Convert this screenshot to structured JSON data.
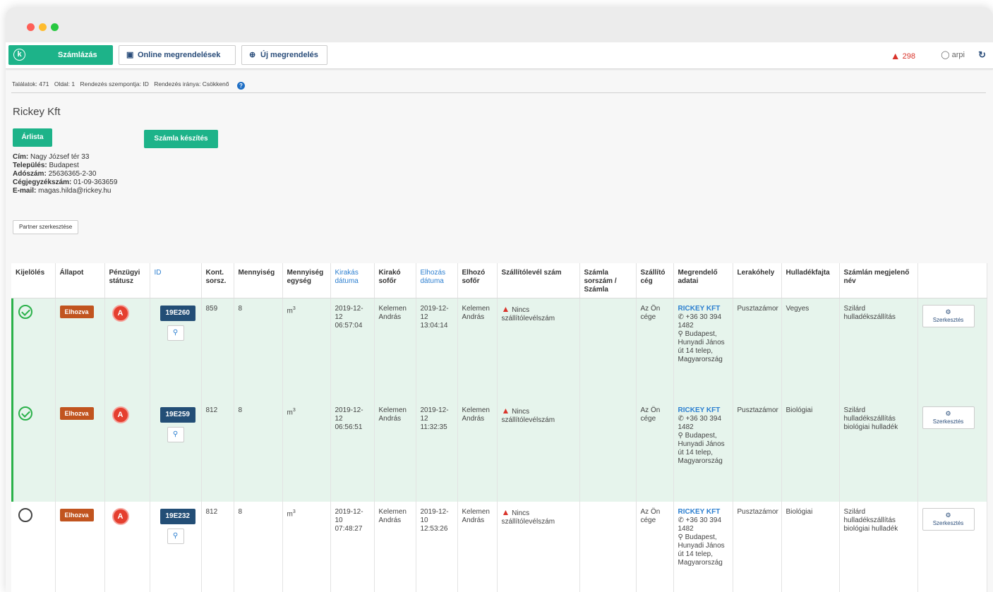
{
  "navbar": {
    "brand_logo": "k",
    "brand_label": "Számlázás",
    "online_orders": "Online megrendelések",
    "new_order": "Új megrendelés",
    "alert_count": "298",
    "user": "arpi"
  },
  "meta": {
    "results": "Találatok: 471",
    "page": "Oldal: 1",
    "sort_by": "Rendezés szempontja: ID",
    "sort_dir": "Rendezés iránya: Csökkenő"
  },
  "partner": {
    "name": "Rickey Kft",
    "btn_arlista": "Árlista",
    "btn_szamla": "Számla készítés",
    "address_label": "Cím:",
    "address": "Nagy József tér 33",
    "city_label": "Település:",
    "city": "Budapest",
    "tax_label": "Adószám:",
    "tax": "25636365-2-30",
    "reg_label": "Cégjegyzékszám:",
    "reg": "01-09-363659",
    "email_label": "E-mail:",
    "email": "magas.hilda@rickey.hu",
    "edit_btn": "Partner szerkesztése"
  },
  "table": {
    "headers": {
      "kijeloles": "Kijelölés",
      "allapot": "Állapot",
      "penzugyi": "Pénzügyi státusz",
      "id": "ID",
      "kont": "Kont. sorsz.",
      "mennyiseg": "Mennyiség",
      "egyseg": "Mennyiség egység",
      "kirakas": "Kirakás dátuma",
      "kirako": "Kirakó sofőr",
      "elhozas": "Elhozás dátuma",
      "elhozo": "Elhozó sofőr",
      "szallitolevel": "Szállítólevél szám",
      "szamla": "Számla sorszám / Számla",
      "szallito": "Szállító cég",
      "megrendelo": "Megrendelő adatai",
      "lerakohely": "Lerakóhely",
      "hulladek": "Hulladékfajta",
      "szamlan": "Számlán megjelenő név"
    },
    "rows": [
      {
        "status": "Elhozva",
        "fin": "A",
        "id": "19E260",
        "kont": "859",
        "qty": "8",
        "unit": "m",
        "unit_sup": "3",
        "kirakas_date": "2019-12-12",
        "kirakas_time": "06:57:04",
        "kirako": "Kelemen András",
        "elhozas_date": "2019-12-12",
        "elhozas_time": "13:04:14",
        "elhozo": "Kelemen András",
        "waybill": "Nincs szállítólevélszám",
        "invoice": "",
        "carrier": "Az Ön cége",
        "customer": "RICKEY KFT",
        "phone": "+36 30 394 1482",
        "address": "Budapest, Hunyadi János út 14 telep, Magyarország",
        "dump": "Pusztazámor",
        "waste": "Vegyes",
        "invoice_name": "Szilárd hulladékszállítás",
        "edit": "Szerkesztés"
      },
      {
        "status": "Elhozva",
        "fin": "A",
        "id": "19E259",
        "kont": "812",
        "qty": "8",
        "unit": "m",
        "unit_sup": "3",
        "kirakas_date": "2019-12-12",
        "kirakas_time": "06:56:51",
        "kirako": "Kelemen András",
        "elhozas_date": "2019-12-12",
        "elhozas_time": "11:32:35",
        "elhozo": "Kelemen András",
        "waybill": "Nincs szállítólevélszám",
        "invoice": "",
        "carrier": "Az Ön cége",
        "customer": "RICKEY KFT",
        "phone": "+36 30 394 1482",
        "address": "Budapest, Hunyadi János út 14 telep, Magyarország",
        "dump": "Pusztazámor",
        "waste": "Biológiai",
        "invoice_name": "Szilárd hulladékszállítás biológiai hulladék",
        "edit": "Szerkesztés"
      },
      {
        "status": "Elhozva",
        "fin": "A",
        "id": "19E232",
        "kont": "812",
        "qty": "8",
        "unit": "m",
        "unit_sup": "3",
        "kirakas_date": "2019-12-10",
        "kirakas_time": "07:48:27",
        "kirako": "Kelemen András",
        "elhozas_date": "2019-12-10",
        "elhozas_time": "12:53:26",
        "elhozo": "Kelemen András",
        "waybill": "Nincs szállítólevélszám",
        "invoice": "",
        "carrier": "Az Ön cége",
        "customer": "RICKEY KFT",
        "phone": "+36 30 394 1482",
        "address": "Budapest, Hunyadi János út 14 telep, Magyarország",
        "dump": "Pusztazámor",
        "waste": "Biológiai",
        "invoice_name": "Szilárd hulladékszállítás biológiai hulladék",
        "edit": "Szerkesztés"
      }
    ]
  }
}
